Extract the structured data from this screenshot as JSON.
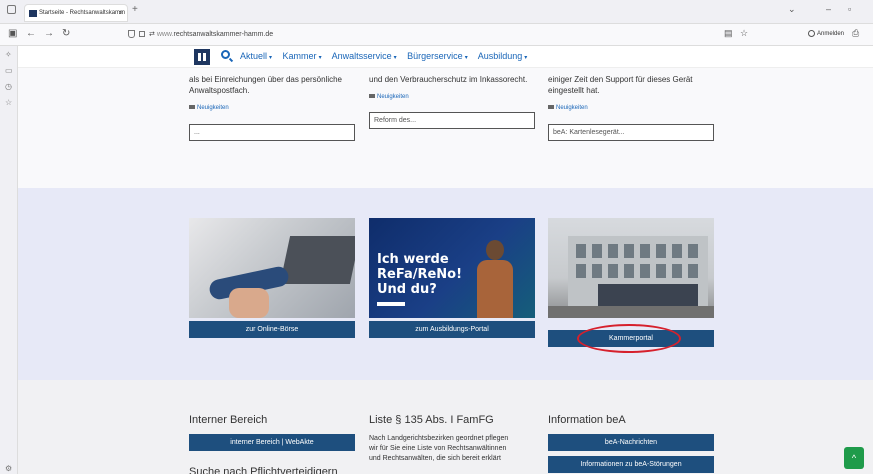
{
  "browser": {
    "tab_title": "Startseite - Rechtsanwaltskamm",
    "tab_close": "×",
    "new_tab": "+",
    "url_domain": "www.",
    "url_host": "rechtsanwaltskammer-hamm.de",
    "signin_label": "Anmelden"
  },
  "site_nav": {
    "items": [
      {
        "label": "Aktuell"
      },
      {
        "label": "Kammer"
      },
      {
        "label": "Anwaltsservice"
      },
      {
        "label": "Bürgerservice"
      },
      {
        "label": "Ausbildung"
      }
    ],
    "caret": "▾"
  },
  "news": [
    {
      "text_line1": "als bei Einreichungen über das persönliche",
      "text_line2": "Anwaltspostfach.",
      "tag": "Neuigkeiten",
      "link": "..."
    },
    {
      "text_line1": "und den Verbraucherschutz im Inkassorecht.",
      "text_line2": "",
      "tag": "Neuigkeiten",
      "link": "Reform des..."
    },
    {
      "text_line1": "einiger Zeit den Support für dieses Gerät",
      "text_line2": "eingestellt hat.",
      "tag": "Neuigkeiten",
      "link": "beA: Kartenlesegerät..."
    }
  ],
  "cards": [
    {
      "button": "zur Online-Börse"
    },
    {
      "button": "zum Ausbildungs-Portal",
      "promo_line1": "Ich werde",
      "promo_line2": "ReFa/ReNo!",
      "promo_line3": "Und du?"
    },
    {
      "button": "Kammerportal"
    }
  ],
  "bottom": {
    "col1": {
      "heading": "Interner Bereich",
      "button": "interner Bereich | WebAkte",
      "heading2": "Suche nach Pflichtverteidigern"
    },
    "col2": {
      "heading": "Liste § 135 Abs. I FamFG",
      "text_line1": "Nach Landgerichtsbezirken geordnet pflegen",
      "text_line2": "wir für Sie eine Liste von Rechtsanwältinnen",
      "text_line3": "und Rechtsanwälten, die sich bereit erklärt"
    },
    "col3": {
      "heading": "Information beA",
      "button1": "beA-Nachrichten",
      "button2": "Informationen zu beA-Störungen"
    }
  },
  "scroll_top_icon": "^",
  "colors": {
    "brand_navy": "#1e4f7e",
    "link_blue": "#1a66b8",
    "highlight_red": "#d6202c",
    "section_lavender": "#e7e9f7"
  }
}
